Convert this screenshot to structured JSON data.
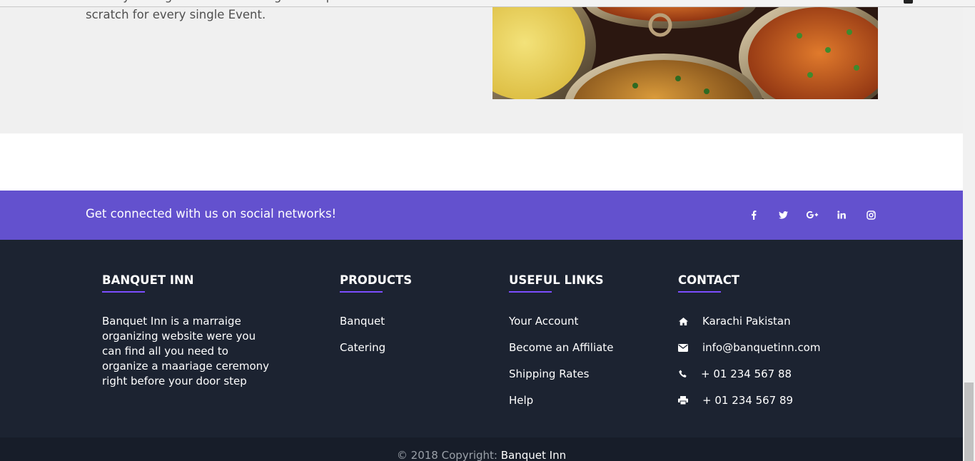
{
  "about": {
    "text_line1": "staff by saving them from having to compose resources from",
    "text_line2": "scratch for every single Event."
  },
  "social": {
    "title": "Get connected with us on social networks!",
    "icons": [
      "facebook-icon",
      "twitter-icon",
      "google-plus-icon",
      "linkedin-icon",
      "instagram-icon"
    ]
  },
  "footer": {
    "brand": {
      "heading": "BANQUET INN",
      "description": "Banquet Inn is a marraige organizing website were you can find all you need to organize a maariage ceremony right before your door step"
    },
    "products": {
      "heading": "PRODUCTS",
      "items": [
        "Banquet",
        "Catering"
      ]
    },
    "useful_links": {
      "heading": "USEFUL LINKS",
      "items": [
        "Your Account",
        "Become an Affiliate",
        "Shipping Rates",
        "Help"
      ]
    },
    "contact": {
      "heading": "CONTACT",
      "address": "Karachi Pakistan",
      "email": "info@banquetinn.com",
      "phone": "+ 01 234 567 88",
      "fax": "+ 01 234 567 89"
    },
    "accent_color": "#7c4dff"
  },
  "copyright": {
    "prefix": "© 2018 Copyright:",
    "link": "Banquet Inn"
  },
  "colors": {
    "social_bar": "#6351ce",
    "footer_bg": "#1c2331",
    "copyright_bg": "#171d29"
  }
}
